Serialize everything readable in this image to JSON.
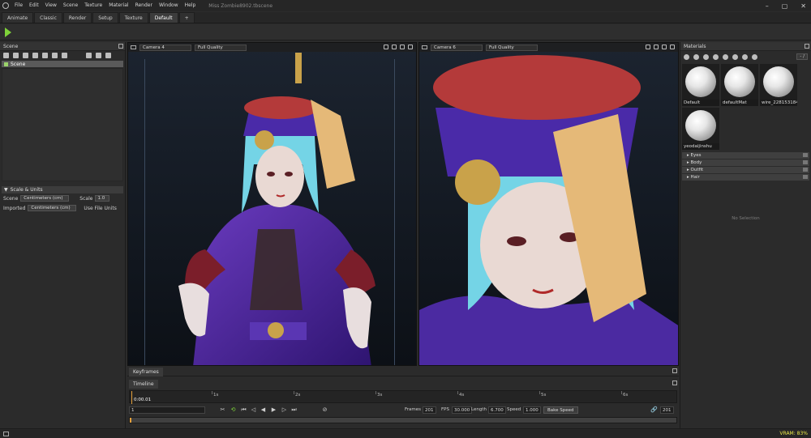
{
  "menu": {
    "items": [
      "File",
      "Edit",
      "View",
      "Scene",
      "Texture",
      "Material",
      "Render",
      "Window",
      "Help"
    ],
    "window_title": "Miss Zombie8902.tbscene"
  },
  "tabs": [
    {
      "label": "Animate",
      "active": false
    },
    {
      "label": "Classic",
      "active": false
    },
    {
      "label": "Render",
      "active": false
    },
    {
      "label": "Setup",
      "active": false
    },
    {
      "label": "Texture",
      "active": false
    },
    {
      "label": "Default",
      "active": true
    },
    {
      "label": "+",
      "active": false
    }
  ],
  "scene_panel": {
    "title": "Scene",
    "root_item": "Scene",
    "scale_units": {
      "title": "Scale & Units",
      "scene_label": "Scene",
      "scene_unit": "Centimeters (cm)",
      "scale_label": "Scale",
      "scale_value": "1.0",
      "imported_label": "Imported",
      "imported_unit": "Centimeters (cm)",
      "use_file_units": "Use File Units"
    }
  },
  "viewport_left": {
    "camera": "Camera 4",
    "quality": "Full Quality"
  },
  "viewport_right": {
    "camera": "Camera 6",
    "quality": "Full Quality"
  },
  "materials_panel": {
    "title": "Materials",
    "page": "- /",
    "materials": [
      "Default",
      "defaultMat",
      "wire_228153184",
      "yeodaijinshu"
    ],
    "groups": [
      "Eyes",
      "Body",
      "Outfit",
      "Hair"
    ],
    "no_selection": "No Selection"
  },
  "keyframes": {
    "tab": "Keyframes"
  },
  "timeline": {
    "tab": "Timeline",
    "current_time": "0:00.01",
    "ticks": [
      "1s",
      "2s",
      "3s",
      "4s",
      "5s",
      "6s"
    ],
    "frame_input": "1",
    "frames_label": "Frames",
    "frames_value": "201",
    "fps_label": "FPS",
    "fps_value": "30.000",
    "length_label": "Length",
    "length_value": "6.700",
    "speed_label": "Speed",
    "speed_value": "1.000",
    "bake_speed": "Bake Speed",
    "end_frame": "201"
  },
  "status": {
    "vram": "VRAM: 83%"
  },
  "colors": {
    "accent_play": "#7fd33a",
    "playhead": "#e5a03a",
    "vram": "#e8e84a"
  }
}
